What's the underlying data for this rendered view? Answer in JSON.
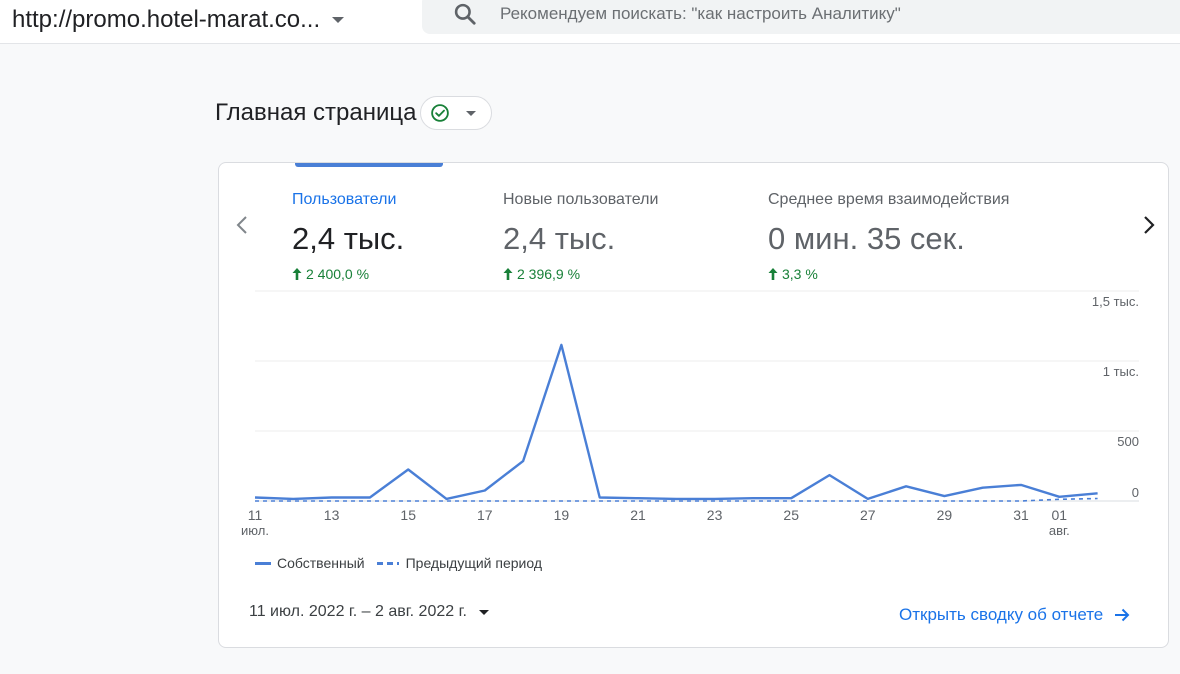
{
  "topbar": {
    "property_name": "http://promo.hotel-marat.co...",
    "search_placeholder": "Рекомендуем поискать: \"как настроить Аналитику\""
  },
  "page": {
    "title": "Главная страница",
    "status_icon": "check-circle-icon"
  },
  "metrics": [
    {
      "label": "Пользователи",
      "value": "2,4 тыс.",
      "change": "2 400,0 %",
      "active": true
    },
    {
      "label": "Новые пользователи",
      "value": "2,4 тыс.",
      "change": "2 396,9 %",
      "active": false
    },
    {
      "label": "Среднее время взаимодействия",
      "value": "0 мин. 35 сек.",
      "change": "3,3 %",
      "active": false
    }
  ],
  "colors": {
    "accent": "#1a73e8",
    "series": "#4a7fd6",
    "positive": "#188038"
  },
  "chart_data": {
    "type": "line",
    "x": [
      "11 июл.",
      "12",
      "13",
      "14",
      "15",
      "16",
      "17",
      "18",
      "19",
      "20",
      "21",
      "22",
      "23",
      "24",
      "25",
      "26",
      "27",
      "28",
      "29",
      "30",
      "31",
      "01 авг.",
      "02"
    ],
    "x_tick_labels": [
      {
        "day": "11",
        "month": "июл."
      },
      {
        "day": "13"
      },
      {
        "day": "15"
      },
      {
        "day": "17"
      },
      {
        "day": "19"
      },
      {
        "day": "21"
      },
      {
        "day": "23"
      },
      {
        "day": "25"
      },
      {
        "day": "27"
      },
      {
        "day": "29"
      },
      {
        "day": "31"
      },
      {
        "day": "01",
        "month": "авг."
      }
    ],
    "y_ticks": [
      {
        "value": 0,
        "label": "0"
      },
      {
        "value": 500,
        "label": "500"
      },
      {
        "value": 1000,
        "label": "1 тыс."
      },
      {
        "value": 1500,
        "label": "1,5 тыс."
      }
    ],
    "ylim": [
      0,
      1500
    ],
    "series": [
      {
        "name": "Собственный",
        "style": "solid",
        "values": [
          25,
          15,
          25,
          25,
          225,
          15,
          75,
          285,
          1115,
          25,
          20,
          15,
          15,
          20,
          20,
          185,
          15,
          105,
          35,
          95,
          115,
          30,
          55
        ]
      },
      {
        "name": "Предыдущий период",
        "style": "dashed",
        "values": [
          0,
          0,
          0,
          0,
          0,
          0,
          0,
          0,
          0,
          0,
          0,
          0,
          0,
          0,
          0,
          0,
          0,
          0,
          0,
          0,
          0,
          12,
          18
        ]
      }
    ],
    "grid": true,
    "legend": "bottom-left"
  },
  "date_range": {
    "label": "11 июл. 2022 г. – 2 авг. 2022 г."
  },
  "report_link": {
    "label": "Открыть сводку об отчете"
  }
}
